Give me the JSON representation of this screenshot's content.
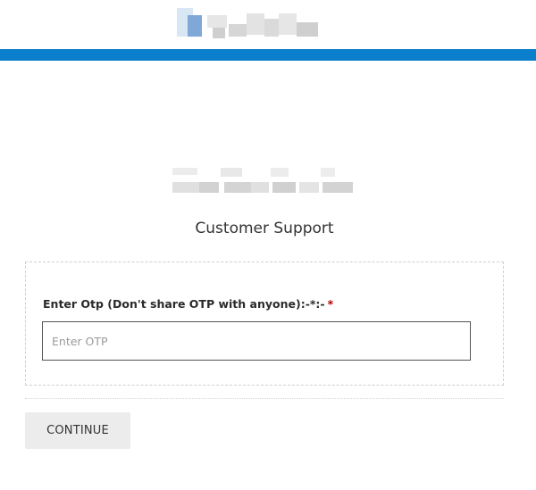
{
  "header": {
    "logo_name": "brand-logo-blurred",
    "bar_color": "#0b7fcb"
  },
  "content_logo": {
    "name": "secondary-logo-blurred"
  },
  "page": {
    "title": "Customer Support"
  },
  "form": {
    "otp_label": "Enter Otp (Don't share OTP with anyone):-*:-",
    "required_marker": "*",
    "otp_placeholder": "Enter OTP",
    "otp_value": ""
  },
  "actions": {
    "continue_label": "CONTINUE"
  }
}
